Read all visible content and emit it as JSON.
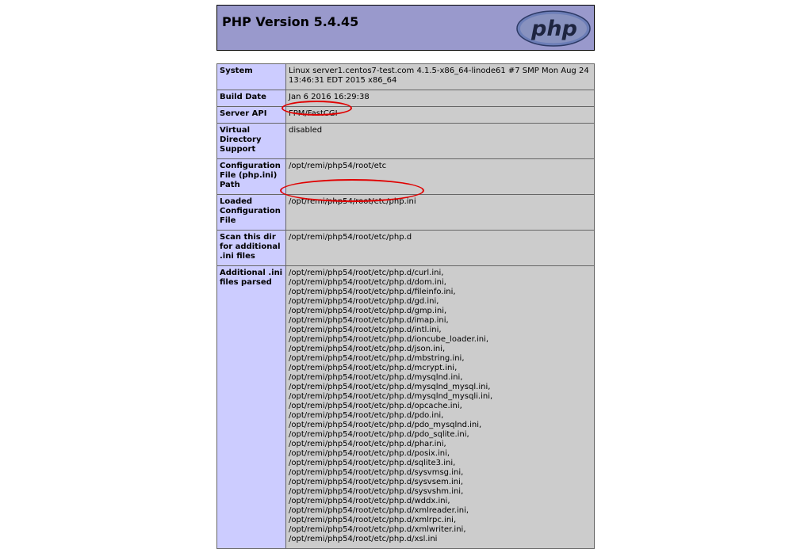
{
  "header": {
    "title": "PHP Version 5.4.45",
    "logo_text": "php"
  },
  "rows": [
    {
      "label": "System",
      "value": "Linux server1.centos7-test.com 4.1.5-x86_64-linode61 #7 SMP Mon Aug 24 13:46:31 EDT 2015 x86_64"
    },
    {
      "label": "Build Date",
      "value": "Jan 6 2016 16:29:38"
    },
    {
      "label": "Server API",
      "value": "FPM/FastCGI"
    },
    {
      "label": "Virtual Directory Support",
      "value": "disabled"
    },
    {
      "label": "Configuration File (php.ini) Path",
      "value": "/opt/remi/php54/root/etc"
    },
    {
      "label": "Loaded Configuration File",
      "value": "/opt/remi/php54/root/etc/php.ini"
    },
    {
      "label": "Scan this dir for additional .ini files",
      "value": "/opt/remi/php54/root/etc/php.d"
    },
    {
      "label": "Additional .ini files parsed",
      "value": "/opt/remi/php54/root/etc/php.d/curl.ini, /opt/remi/php54/root/etc/php.d/dom.ini, /opt/remi/php54/root/etc/php.d/fileinfo.ini, /opt/remi/php54/root/etc/php.d/gd.ini, /opt/remi/php54/root/etc/php.d/gmp.ini, /opt/remi/php54/root/etc/php.d/imap.ini, /opt/remi/php54/root/etc/php.d/intl.ini, /opt/remi/php54/root/etc/php.d/ioncube_loader.ini, /opt/remi/php54/root/etc/php.d/json.ini, /opt/remi/php54/root/etc/php.d/mbstring.ini, /opt/remi/php54/root/etc/php.d/mcrypt.ini, /opt/remi/php54/root/etc/php.d/mysqlnd.ini, /opt/remi/php54/root/etc/php.d/mysqlnd_mysql.ini, /opt/remi/php54/root/etc/php.d/mysqlnd_mysqli.ini, /opt/remi/php54/root/etc/php.d/opcache.ini, /opt/remi/php54/root/etc/php.d/pdo.ini, /opt/remi/php54/root/etc/php.d/pdo_mysqlnd.ini, /opt/remi/php54/root/etc/php.d/pdo_sqlite.ini, /opt/remi/php54/root/etc/php.d/phar.ini, /opt/remi/php54/root/etc/php.d/posix.ini, /opt/remi/php54/root/etc/php.d/sqlite3.ini, /opt/remi/php54/root/etc/php.d/sysvmsg.ini, /opt/remi/php54/root/etc/php.d/sysvsem.ini, /opt/remi/php54/root/etc/php.d/sysvshm.ini, /opt/remi/php54/root/etc/php.d/wddx.ini, /opt/remi/php54/root/etc/php.d/xmlreader.ini, /opt/remi/php54/root/etc/php.d/xmlrpc.ini, /opt/remi/php54/root/etc/php.d/xmlwriter.ini, /opt/remi/php54/root/etc/php.d/xsl.ini"
    }
  ],
  "colors": {
    "header_bg": "#9999cc",
    "label_bg": "#ccccff",
    "value_bg": "#cccccc",
    "highlight_circle": "#e00000"
  }
}
